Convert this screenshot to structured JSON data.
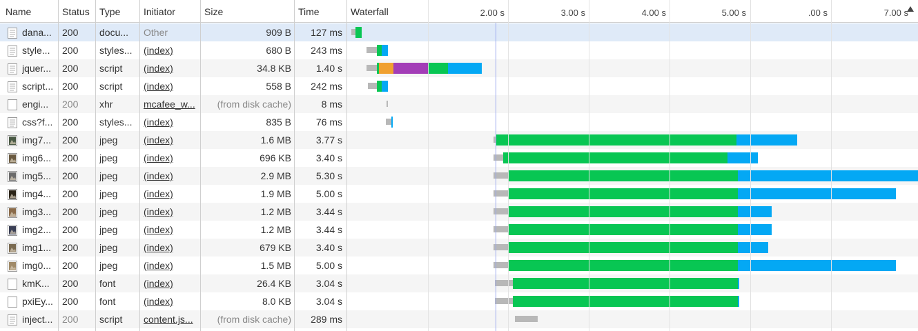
{
  "columns": {
    "name": "Name",
    "status": "Status",
    "type": "Type",
    "initiator": "Initiator",
    "size": "Size",
    "time": "Time",
    "waterfall": "Waterfall"
  },
  "timeline": {
    "tick_labels": [
      "2.00 s",
      "3.00 s",
      "4.00 s",
      "5.00 s",
      ".00 s",
      "7.00 s"
    ],
    "sort": "descending",
    "colors": {
      "queue": "#b8b8b8",
      "dns": "#f0a030",
      "connect": "#a33db7",
      "wait": "#08c653",
      "download": "#04a8f4"
    }
  },
  "requests": [
    {
      "name": "dana...",
      "status": "200",
      "type": "docu...",
      "initiator": "Other",
      "initiator_link": false,
      "size": "909 B",
      "time": "127 ms",
      "icon": "document-icon",
      "selected": true,
      "status_muted": false,
      "size_muted": false
    },
    {
      "name": "style...",
      "status": "200",
      "type": "styles...",
      "initiator": "(index)",
      "initiator_link": true,
      "size": "680 B",
      "time": "243 ms",
      "icon": "document-icon",
      "status_muted": false,
      "size_muted": false
    },
    {
      "name": "jquer...",
      "status": "200",
      "type": "script",
      "initiator": "(index)",
      "initiator_link": true,
      "size": "34.8 KB",
      "time": "1.40 s",
      "icon": "document-icon",
      "status_muted": false,
      "size_muted": false
    },
    {
      "name": "script...",
      "status": "200",
      "type": "script",
      "initiator": "(index)",
      "initiator_link": true,
      "size": "558 B",
      "time": "242 ms",
      "icon": "document-icon",
      "status_muted": false,
      "size_muted": false
    },
    {
      "name": "engi...",
      "status": "200",
      "type": "xhr",
      "initiator": "mcafee_w...",
      "initiator_link": true,
      "size": "(from disk cache)",
      "time": "8 ms",
      "icon": "blank-file-icon",
      "status_muted": true,
      "size_muted": true
    },
    {
      "name": "css?f...",
      "status": "200",
      "type": "styles...",
      "initiator": "(index)",
      "initiator_link": true,
      "size": "835 B",
      "time": "76 ms",
      "icon": "document-icon",
      "status_muted": false,
      "size_muted": false
    },
    {
      "name": "img7...",
      "status": "200",
      "type": "jpeg",
      "initiator": "(index)",
      "initiator_link": true,
      "size": "1.6 MB",
      "time": "3.77 s",
      "icon": "image-thumbnail-icon",
      "status_muted": false,
      "size_muted": false
    },
    {
      "name": "img6...",
      "status": "200",
      "type": "jpeg",
      "initiator": "(index)",
      "initiator_link": true,
      "size": "696 KB",
      "time": "3.40 s",
      "icon": "image-thumbnail-icon",
      "status_muted": false,
      "size_muted": false
    },
    {
      "name": "img5...",
      "status": "200",
      "type": "jpeg",
      "initiator": "(index)",
      "initiator_link": true,
      "size": "2.9 MB",
      "time": "5.30 s",
      "icon": "image-thumbnail-icon",
      "status_muted": false,
      "size_muted": false
    },
    {
      "name": "img4...",
      "status": "200",
      "type": "jpeg",
      "initiator": "(index)",
      "initiator_link": true,
      "size": "1.9 MB",
      "time": "5.00 s",
      "icon": "image-thumbnail-icon",
      "status_muted": false,
      "size_muted": false
    },
    {
      "name": "img3...",
      "status": "200",
      "type": "jpeg",
      "initiator": "(index)",
      "initiator_link": true,
      "size": "1.2 MB",
      "time": "3.44 s",
      "icon": "image-thumbnail-icon",
      "status_muted": false,
      "size_muted": false
    },
    {
      "name": "img2...",
      "status": "200",
      "type": "jpeg",
      "initiator": "(index)",
      "initiator_link": true,
      "size": "1.2 MB",
      "time": "3.44 s",
      "icon": "image-thumbnail-icon",
      "status_muted": false,
      "size_muted": false
    },
    {
      "name": "img1...",
      "status": "200",
      "type": "jpeg",
      "initiator": "(index)",
      "initiator_link": true,
      "size": "679 KB",
      "time": "3.40 s",
      "icon": "image-thumbnail-icon",
      "status_muted": false,
      "size_muted": false
    },
    {
      "name": "img0...",
      "status": "200",
      "type": "jpeg",
      "initiator": "(index)",
      "initiator_link": true,
      "size": "1.5 MB",
      "time": "5.00 s",
      "icon": "image-thumbnail-icon",
      "status_muted": false,
      "size_muted": false
    },
    {
      "name": "kmK...",
      "status": "200",
      "type": "font",
      "initiator": "(index)",
      "initiator_link": true,
      "size": "26.4 KB",
      "time": "3.04 s",
      "icon": "blank-file-icon",
      "status_muted": false,
      "size_muted": false
    },
    {
      "name": "pxiEy...",
      "status": "200",
      "type": "font",
      "initiator": "(index)",
      "initiator_link": true,
      "size": "8.0 KB",
      "time": "3.04 s",
      "icon": "blank-file-icon",
      "status_muted": false,
      "size_muted": false
    },
    {
      "name": "inject...",
      "status": "200",
      "type": "script",
      "initiator": "content.js...",
      "initiator_link": true,
      "size": "(from disk cache)",
      "time": "289 ms",
      "icon": "document-icon",
      "status_muted": true,
      "size_muted": true
    }
  ]
}
